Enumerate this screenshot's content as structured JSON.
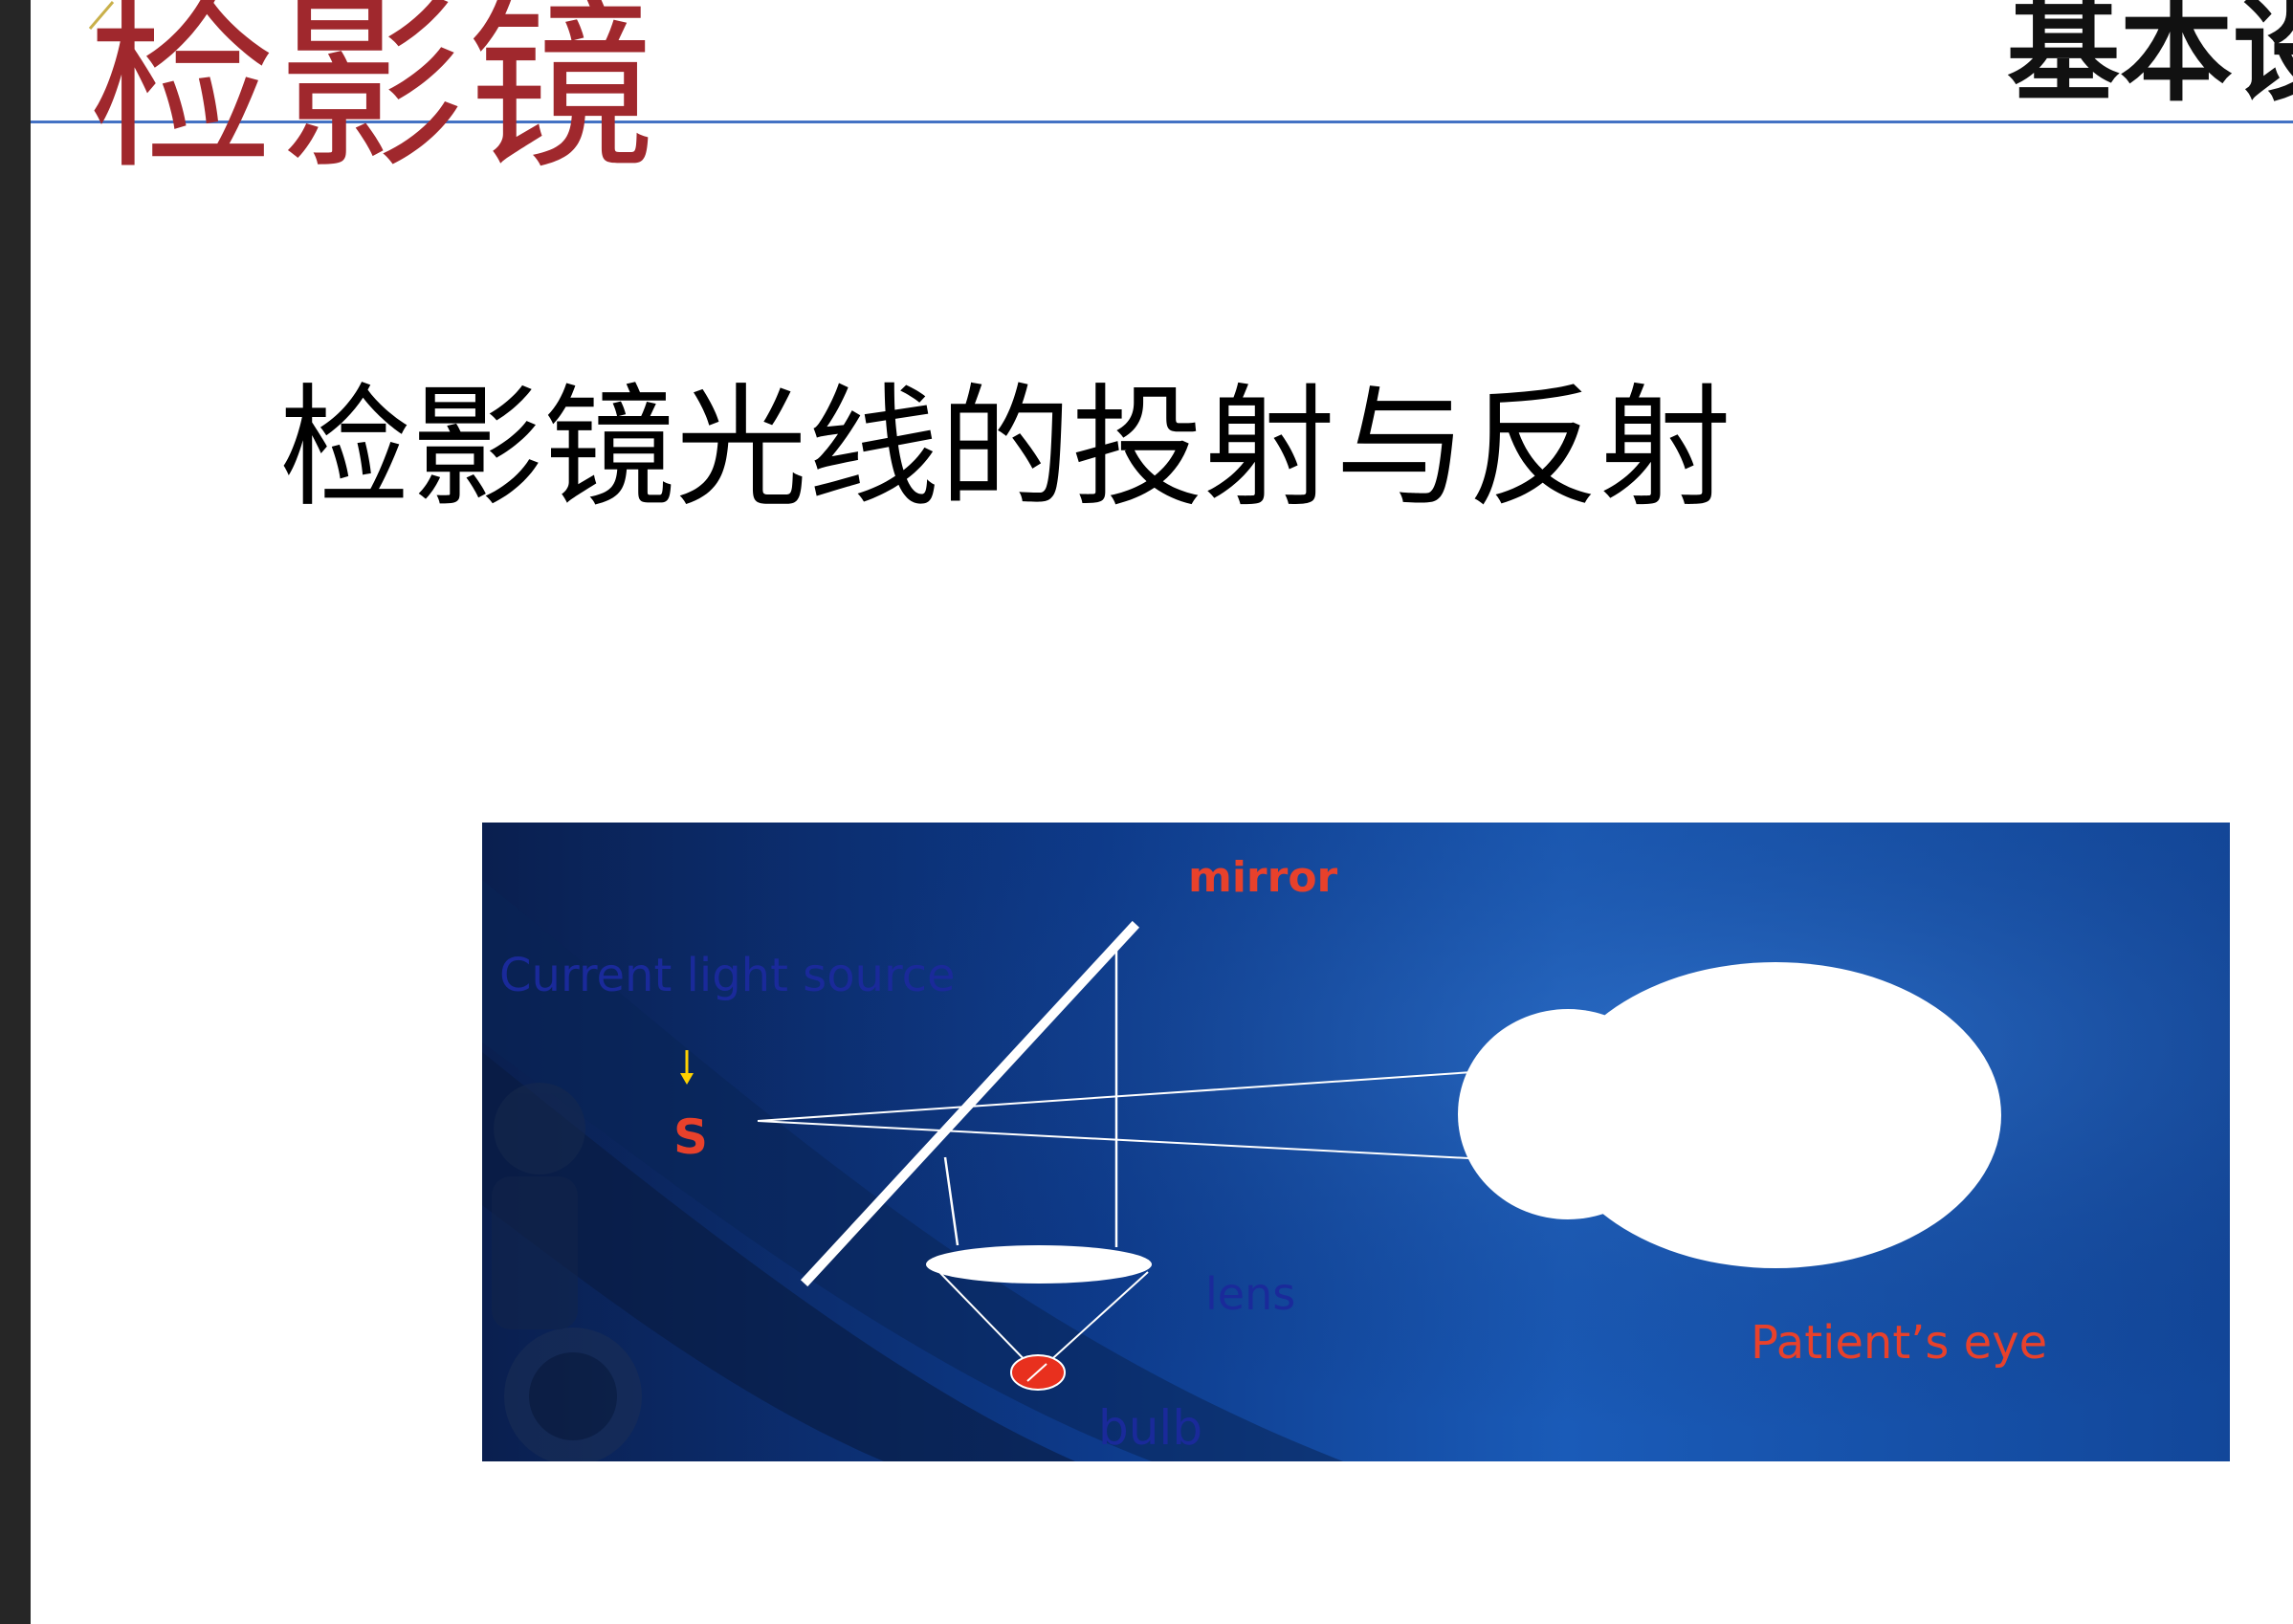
{
  "header": {
    "title": "检影镜",
    "section": "基本设"
  },
  "subtitle": "检影镜光线的投射与反射",
  "diagram": {
    "labels": {
      "mirror": "mirror",
      "source": "Current light  source",
      "s": "S",
      "lens": "lens",
      "bulb": "bulb",
      "eye": "Patient’s eye"
    },
    "colors": {
      "label_red": "#e8412b",
      "label_blue": "#1a2a9a",
      "arrow_yellow": "#ffd200",
      "bulb_red": "#e8301e",
      "title_red": "#a0282d",
      "rule_blue": "#4472c4"
    },
    "icons": [
      "down-arrow-icon"
    ]
  }
}
